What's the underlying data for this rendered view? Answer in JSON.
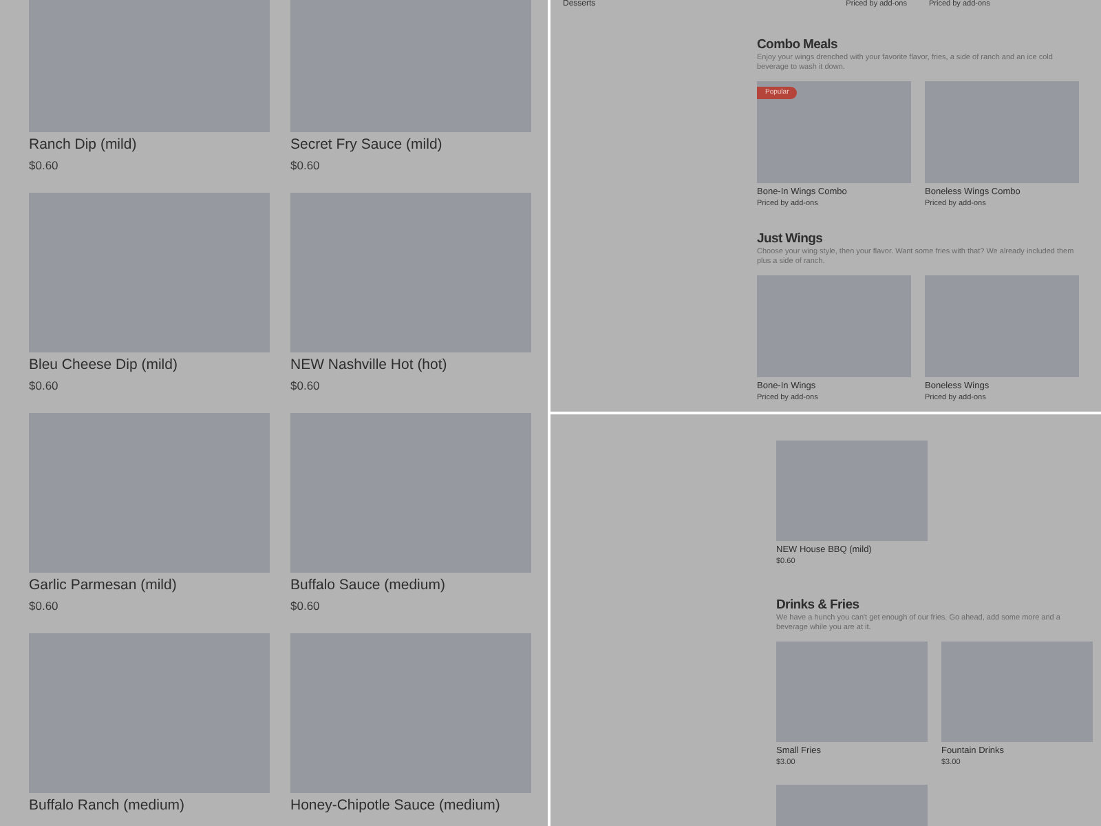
{
  "panels": [
    {
      "kind": "grid",
      "items": [
        {
          "name": "Ranch Dip (mild)",
          "price": "$0.60"
        },
        {
          "name": "Secret Fry Sauce (mild)",
          "price": "$0.60"
        },
        {
          "name": "Bleu Cheese Dip (mild)",
          "price": "$0.60"
        },
        {
          "name": "NEW Nashville Hot (hot)",
          "price": "$0.60"
        },
        {
          "name": "Garlic Parmesan (mild)",
          "price": "$0.60"
        },
        {
          "name": "Buffalo Sauce (medium)",
          "price": "$0.60"
        },
        {
          "name": "Buffalo Ranch (medium)"
        },
        {
          "name": "Honey-Chipotle Sauce (medium)"
        }
      ]
    },
    {
      "kind": "menu",
      "sidebar": [
        "Desserts"
      ],
      "leading": [
        "Priced by add-ons",
        "Priced by add-ons"
      ],
      "sections": [
        {
          "title": "Combo Meals",
          "description": "Enjoy your wings drenched with your favorite flavor, fries, a side of ranch and an ice cold beverage to wash it down.",
          "items": [
            {
              "name": "Bone-In Wings Combo",
              "price": "Priced by add-ons",
              "badge": "Popular"
            },
            {
              "name": "Boneless Wings Combo",
              "price": "Priced by add-ons"
            }
          ]
        },
        {
          "title": "Just Wings",
          "description": "Choose your wing style, then your flavor. Want some fries with that? We already included them plus a side of ranch.",
          "items": [
            {
              "name": "Bone-In Wings",
              "price": "Priced by add-ons"
            },
            {
              "name": "Boneless Wings",
              "price": "Priced by add-ons"
            }
          ]
        }
      ]
    },
    {
      "kind": "menu",
      "sections": [
        {
          "items": [
            {
              "name": "NEW House BBQ (mild)",
              "price": "$0.60"
            }
          ]
        },
        {
          "title": "Drinks & Fries",
          "description": "We have a hunch you can't get enough of our fries. Go ahead, add some more and a beverage while you are at it.",
          "items": [
            {
              "name": "Small Fries",
              "price": "$3.00"
            },
            {
              "name": "Fountain Drinks",
              "price": "$3.00"
            },
            {
              "kind": "picture"
            }
          ]
        }
      ]
    }
  ]
}
